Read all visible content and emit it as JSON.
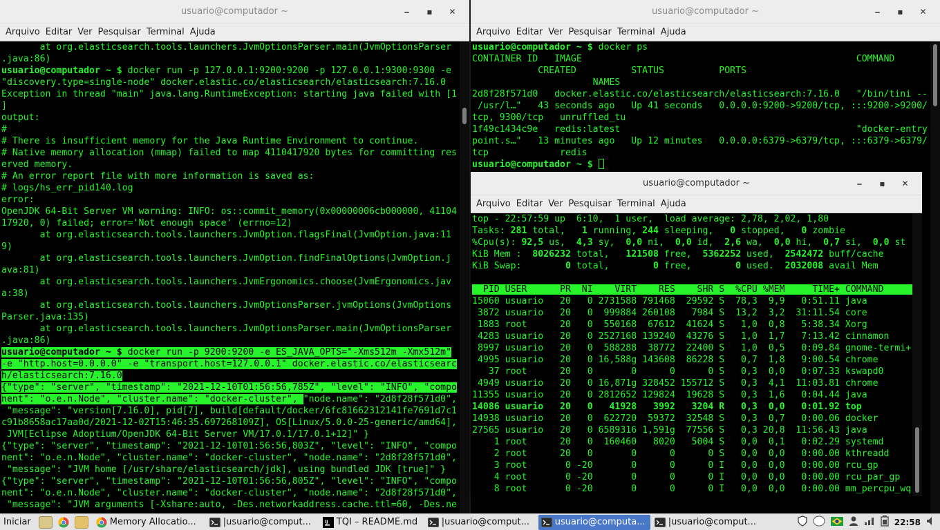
{
  "menu": [
    "Arquivo",
    "Editar",
    "Ver",
    "Pesquisar",
    "Terminal",
    "Ajuda"
  ],
  "window_controls": [
    "⎯",
    "▪",
    "✕"
  ],
  "windows": {
    "left": {
      "title": "usuario@computador ~",
      "lines": [
        [
          {
            "t": "       at org.elasticsearch.tools.launchers.JvmOptionsParser.main(JvmOptionsParser"
          }
        ],
        [
          {
            "t": ".java:86)"
          }
        ],
        [
          {
            "t": "usuario@computador ~ $ ",
            "b": 1
          },
          {
            "t": "docker run -p 127.0.0.1:9200:9200 -p 127.0.0.1:9300:9300 -e"
          }
        ],
        [
          {
            "t": "\"discovery.type=single-node\" docker.elastic.co/elasticsearch/elasticsearch:7.16.0"
          }
        ],
        [
          {
            "t": "Exception in thread \"main\" java.lang.RuntimeException: starting java failed with [1"
          }
        ],
        [
          {
            "t": "]"
          }
        ],
        [
          {
            "t": "output:"
          }
        ],
        [
          {
            "t": "#"
          }
        ],
        [
          {
            "t": "# There is insufficient memory for the Java Runtime Environment to continue."
          }
        ],
        [
          {
            "t": "# Native memory allocation (mmap) failed to map 4110417920 bytes for committing res"
          }
        ],
        [
          {
            "t": "erved memory."
          }
        ],
        [
          {
            "t": "# An error report file with more information is saved as:"
          }
        ],
        [
          {
            "t": "# logs/hs_err_pid140.log"
          }
        ],
        [
          {
            "t": "error:"
          }
        ],
        [
          {
            "t": "OpenJDK 64-Bit Server VM warning: INFO: os::commit_memory(0x00000006cb000000, 41104"
          }
        ],
        [
          {
            "t": "17920, 0) failed; error='Not enough space' (errno=12)"
          }
        ],
        [
          {
            "t": "       at org.elasticsearch.tools.launchers.JvmOption.flagsFinal(JvmOption.java:11"
          }
        ],
        [
          {
            "t": "9)"
          }
        ],
        [
          {
            "t": "       at org.elasticsearch.tools.launchers.JvmOption.findFinalOptions(JvmOption.j"
          }
        ],
        [
          {
            "t": "ava:81)"
          }
        ],
        [
          {
            "t": "       at org.elasticsearch.tools.launchers.JvmErgonomics.choose(JvmErgonomics.jav"
          }
        ],
        [
          {
            "t": "a:38)"
          }
        ],
        [
          {
            "t": "       at org.elasticsearch.tools.launchers.JvmOptionsParser.jvmOptions(JvmOptions"
          }
        ],
        [
          {
            "t": "Parser.java:135)"
          }
        ],
        [
          {
            "t": "       at org.elasticsearch.tools.launchers.JvmOptionsParser.main(JvmOptionsParser"
          }
        ],
        [
          {
            "t": ".java:86)"
          }
        ],
        [
          {
            "t": "usuario@computador ~ $ ",
            "b": 1,
            "h": 1
          },
          {
            "t": "docker run -p 9200:9200 -e ES_JAVA_OPTS=\"-Xms512m -Xmx512m\"",
            "h": 1
          }
        ],
        [
          {
            "t": "-e \"http.host=0.0.0.0\" -e \"transport.host=127.0.0.1\" docker.elastic.co/elasticsearc",
            "h": 1
          }
        ],
        [
          {
            "t": "h/elasticsearch:7.16.0",
            "h": 1
          }
        ],
        [
          {
            "t": "{\"type\": \"server\", \"timestamp\": \"2021-12-10T01:56:56,785Z\", \"level\": \"INFO\", \"compo",
            "h": 1
          }
        ],
        [
          {
            "t": "nent\": \"o.e.n.Node\", \"cluster.name\": \"docker-cluster\", ",
            "h": 1
          },
          {
            "t": "\"node.name\": \"2d8f28f571d0\","
          }
        ],
        [
          {
            "t": " \"message\": \"version[7.16.0], pid[7], build[default/docker/6fc81662312141fe7691d7c1"
          }
        ],
        [
          {
            "t": "c91b8658ac17aa0d/2021-12-02T15:46:35.697268109Z], OS[Linux/5.0.0-25-generic/amd64],"
          }
        ],
        [
          {
            "t": " JVM[Eclipse Adoptium/OpenJDK 64-Bit Server VM/17.0.1/17.0.1+12]\" }"
          }
        ],
        [
          {
            "t": "{\"type\": \"server\", \"timestamp\": \"2021-12-10T01:56:56,803Z\", \"level\": \"INFO\", \"compo"
          }
        ],
        [
          {
            "t": "nent\": \"o.e.n.Node\", \"cluster.name\": \"docker-cluster\", \"node.name\": \"2d8f28f571d0\","
          }
        ],
        [
          {
            "t": " \"message\": \"JVM home [/usr/share/elasticsearch/jdk], using bundled JDK [true]\" }"
          }
        ],
        [
          {
            "t": "{\"type\": \"server\", \"timestamp\": \"2021-12-10T01:56:56,805Z\", \"level\": \"INFO\", \"compo"
          }
        ],
        [
          {
            "t": "nent\": \"o.e.n.Node\", \"cluster.name\": \"docker-cluster\", \"node.name\": \"2d8f28f571d0\","
          }
        ],
        [
          {
            "t": " \"message\": \"JVM arguments [-Xshare:auto, -Des.networkaddress.cache.ttl=60, -Des.ne"
          }
        ]
      ]
    },
    "right": {
      "title": "usuario@computador ~",
      "lines": [
        [
          {
            "t": "usuario@computador ~ $ ",
            "b": 1
          },
          {
            "t": "docker ps"
          }
        ],
        [
          {
            "t": "CONTAINER ID   IMAGE                                                  COMMAND"
          }
        ],
        [
          {
            "t": "            CREATED          STATUS          PORTS"
          }
        ],
        [
          {
            "t": "                      NAMES"
          }
        ],
        [
          {
            "t": "2d8f28f571d0   docker.elastic.co/elasticsearch/elasticsearch:7.16.0   \"/bin/tini --"
          }
        ],
        [
          {
            "t": " /usr/l…\"   43 seconds ago   Up 41 seconds   0.0.0.0:9200->9200/tcp, :::9200->9200/"
          }
        ],
        [
          {
            "t": "tcp, 9300/tcp   unruffled_tu"
          }
        ],
        [
          {
            "t": "1f49c1434c9e   redis:latest                                           \"docker-entry"
          }
        ],
        [
          {
            "t": "point.s…\"   13 minutes ago   Up 12 minutes   0.0.0.0:6379->6379/tcp, :::6379->6379/"
          }
        ],
        [
          {
            "t": "tcp             redis"
          }
        ],
        [
          {
            "t": "usuario@computador ~ $ ",
            "b": 1,
            "caret": 1
          }
        ]
      ]
    },
    "top": {
      "title": "usuario@computador ~",
      "lines": [
        [
          {
            "t": "top - 22:57:59 up  6:10,  1 user,  load average: 2,78, 2,02, 1,80"
          }
        ],
        [
          {
            "t": "Tasks: "
          },
          {
            "t": "281",
            "b": 1
          },
          {
            "t": " total,   "
          },
          {
            "t": "1",
            "b": 1
          },
          {
            "t": " running, "
          },
          {
            "t": "244",
            "b": 1
          },
          {
            "t": " sleeping,   "
          },
          {
            "t": "0",
            "b": 1
          },
          {
            "t": " stopped,   "
          },
          {
            "t": "0",
            "b": 1
          },
          {
            "t": " zombie"
          }
        ],
        [
          {
            "t": "%Cpu(s): "
          },
          {
            "t": "92,5",
            "b": 1
          },
          {
            "t": " us,  "
          },
          {
            "t": "4,3",
            "b": 1
          },
          {
            "t": " sy,  "
          },
          {
            "t": "0,0",
            "b": 1
          },
          {
            "t": " ni,  "
          },
          {
            "t": "0,0",
            "b": 1
          },
          {
            "t": " id,  "
          },
          {
            "t": "2,6",
            "b": 1
          },
          {
            "t": " wa,  "
          },
          {
            "t": "0,0",
            "b": 1
          },
          {
            "t": " hi,  "
          },
          {
            "t": "0,7",
            "b": 1
          },
          {
            "t": " si,  "
          },
          {
            "t": "0,0",
            "b": 1
          },
          {
            "t": " st"
          }
        ],
        [
          {
            "t": "KiB Mem :  "
          },
          {
            "t": "8026232",
            "b": 1
          },
          {
            "t": " total,   "
          },
          {
            "t": "121508",
            "b": 1
          },
          {
            "t": " free,  "
          },
          {
            "t": "5362252",
            "b": 1
          },
          {
            "t": " used,  "
          },
          {
            "t": "2542472",
            "b": 1
          },
          {
            "t": " buff/cache"
          }
        ],
        [
          {
            "t": "KiB Swap:        "
          },
          {
            "t": "0",
            "b": 1
          },
          {
            "t": " total,        "
          },
          {
            "t": "0",
            "b": 1
          },
          {
            "t": " free,        "
          },
          {
            "t": "0",
            "b": 1
          },
          {
            "t": " used.  "
          },
          {
            "t": "2032008",
            "b": 1
          },
          {
            "t": " avail Mem"
          }
        ],
        [
          {
            "t": " "
          }
        ],
        [
          {
            "t": "  PID USER      PR  NI    VIRT    RES    SHR S  %CPU %MEM     TIME+ COMMAND       ",
            "hdr": 1
          }
        ],
        [
          {
            "t": "15060 usuario   20   0 2731588 791468  29592 S  78,3  9,9   0:51.11 java"
          }
        ],
        [
          {
            "t": " 3872 usuario   20   0  999884 260108   7984 S  13,2  3,2  31:11.54 core"
          }
        ],
        [
          {
            "t": " 1883 root      20   0  550168  67612  41624 S   1,0  0,8   5:38.34 Xorg"
          }
        ],
        [
          {
            "t": " 4283 usuario   20   0 2527168 139240  43276 S   1,0  1,7   7:13.42 cinnamon"
          }
        ],
        [
          {
            "t": " 8997 usuario   20   0  588288  38772  22400 S   1,0  0,5   0:09.84 gnome-termi+"
          }
        ],
        [
          {
            "t": " 4995 usuario   20   0 16,588g 143608  86228 S   0,7  1,8   9:00.54 chrome"
          }
        ],
        [
          {
            "t": "   37 root      20   0       0      0      0 S   0,3  0,0   0:07.33 kswapd0"
          }
        ],
        [
          {
            "t": " 4949 usuario   20   0 16,871g 328452 155712 S   0,3  4,1  11:03.81 chrome"
          }
        ],
        [
          {
            "t": "11355 usuario   20   0 2812652 129824  19628 S   0,3  1,6   0:04.44 java"
          }
        ],
        [
          {
            "t": "14086 usuario   20   0   41928   3992   3204 R   0,3  0,0   0:01.92 top",
            "b": 1
          }
        ],
        [
          {
            "t": "14938 usuario   20   0  622720  59372  32548 S   0,3  0,7   0:00.06 docker"
          }
        ],
        [
          {
            "t": "27565 usuario   20   0 6589316 1,591g  77556 S   0,3 20,8  11:56.43 java"
          }
        ],
        [
          {
            "t": "    1 root      20   0  160460   8020   5004 S   0,0  0,1   0:02.29 systemd"
          }
        ],
        [
          {
            "t": "    2 root      20   0       0      0      0 S   0,0  0,0   0:00.00 kthreadd"
          }
        ],
        [
          {
            "t": "    3 root       0 -20       0      0      0 I   0,0  0,0   0:00.00 rcu_gp"
          }
        ],
        [
          {
            "t": "    4 root       0 -20       0      0      0 I   0,0  0,0   0:00.00 rcu_par_gp"
          }
        ],
        [
          {
            "t": "    8 root       0 -20       0      0      0 I   0,0  0,0   0:00.00 mm_percpu_wq"
          }
        ]
      ]
    }
  },
  "taskbar": {
    "start": "Iniciar",
    "tasks": [
      {
        "label": "Memory Allocatio...",
        "icon": "chrome-icon",
        "active": false
      },
      {
        "label": "|usuario@comput...",
        "icon": "terminal-icon",
        "active": false
      },
      {
        "label": "TQI – README.md",
        "icon": "jetbrains-icon",
        "active": false
      },
      {
        "label": "|usuario@comput...",
        "icon": "terminal-icon",
        "active": false
      },
      {
        "label": "usuario@computa...",
        "icon": "terminal-icon",
        "active": true
      },
      {
        "label": "|usuario@comput...",
        "icon": "terminal-icon",
        "active": false
      }
    ],
    "clock": "22:58"
  }
}
